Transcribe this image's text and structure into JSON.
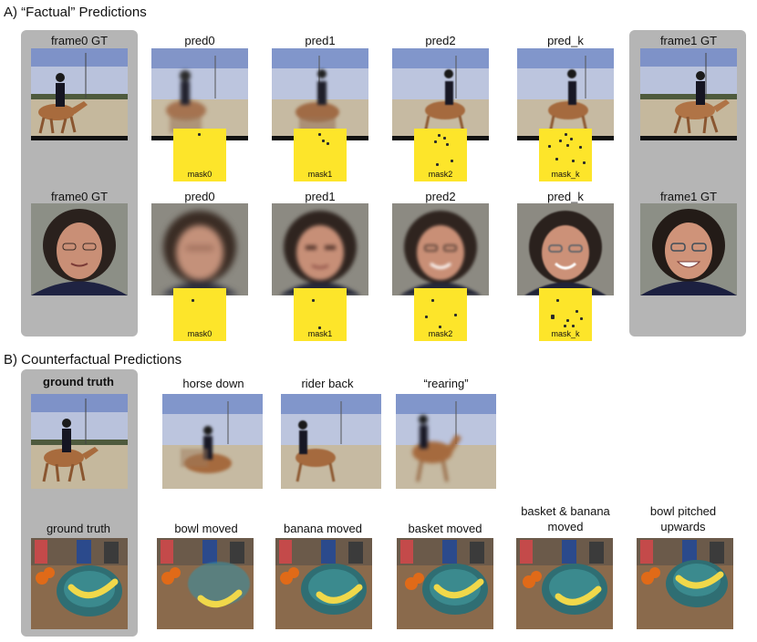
{
  "sectionA": {
    "title": "A) “Factual” Predictions",
    "row1_labels": [
      "frame0 GT",
      "pred0",
      "pred1",
      "pred2",
      "pred_k",
      "frame1  GT"
    ],
    "row2_labels": [
      "frame0 GT",
      "pred0",
      "pred1",
      "pred2",
      "pred_k",
      "frame1 GT"
    ],
    "row1_masks": [
      "mask0",
      "mask1",
      "mask2",
      "mask_k"
    ],
    "row2_masks": [
      "mask0",
      "mask1",
      "mask2",
      "mask_k"
    ]
  },
  "sectionB": {
    "title": "B) Counterfactual Predictions",
    "row1_labels": [
      "ground truth",
      "horse down",
      "rider back",
      "“rearing”"
    ],
    "row2_labels": [
      "ground truth",
      "bowl moved",
      "banana moved",
      "basket moved",
      "basket & banana moved",
      "bowl pitched upwards"
    ]
  }
}
